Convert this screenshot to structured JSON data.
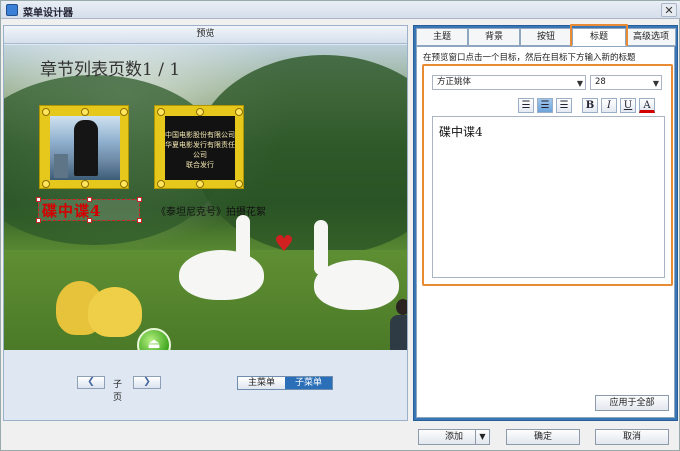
{
  "window": {
    "title": "菜单设计器",
    "close": "✕"
  },
  "preview": {
    "header": "预览",
    "title_text": "章节列表页数1 / 1",
    "thumb2_text": "中国电影股份有限公司\n华夏电影发行有限责任公司\n联合发行",
    "thumb_label_1": "碟中谍4",
    "thumb_label_2": "《泰坦尼克号》拍摄花絮",
    "pager": {
      "prev": "❮",
      "label": "子页",
      "next": "❯"
    },
    "menu_toggle": {
      "main": "主菜单",
      "sub": "子菜单"
    }
  },
  "tabs": [
    {
      "label": "主题",
      "active": false
    },
    {
      "label": "背景",
      "active": false
    },
    {
      "label": "按钮",
      "active": false
    },
    {
      "label": "标题",
      "active": true
    },
    {
      "label": "高级选项",
      "active": false
    }
  ],
  "title_tab": {
    "instruction": "在预览窗口点击一个目标，然后在目标下方输入新的标题",
    "font": "方正姚体",
    "size": "28",
    "align": [
      "left",
      "center",
      "right"
    ],
    "style": {
      "bold": "B",
      "italic": "I",
      "underline": "U",
      "color": "A"
    },
    "text": "碟中谍4",
    "apply_all": "应用于全部"
  },
  "footer": {
    "add": "添加",
    "ok": "确定",
    "cancel": "取消"
  },
  "colors": {
    "accent": "#3976b6",
    "highlight": "#e98b33",
    "label_red": "#d40000"
  }
}
